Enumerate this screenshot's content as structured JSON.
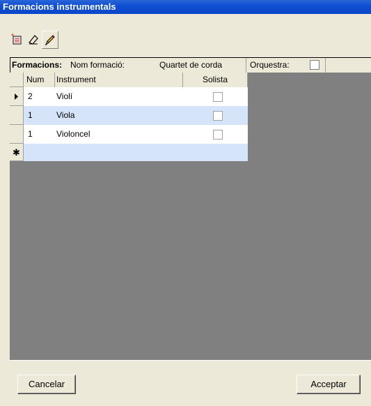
{
  "window": {
    "title": "Formacions instrumentals"
  },
  "toolbar": {
    "buttons": [
      {
        "icon": "new-record-icon"
      },
      {
        "icon": "eraser-icon"
      },
      {
        "icon": "pencil-icon",
        "pressed": true
      }
    ]
  },
  "header": {
    "section_label": "Formacions:",
    "name_label": "Nom formació:",
    "name_value": "Quartet de corda",
    "orchestra_label": "Orquestra:",
    "orchestra_checked": false
  },
  "grid": {
    "columns": [
      "Num",
      "Instrument",
      "Solista"
    ],
    "rows": [
      {
        "num": "2",
        "instrument": "Violí",
        "solista": false,
        "current": true
      },
      {
        "num": "1",
        "instrument": "Viola",
        "solista": false
      },
      {
        "num": "1",
        "instrument": "Violoncel",
        "solista": false
      }
    ],
    "new_row_marker": "✱"
  },
  "footer": {
    "cancel_label": "Cancelar",
    "accept_label": "Acceptar"
  },
  "colors": {
    "title_bar": "#0a46c8",
    "row_alt": "#d6e4fa",
    "row": "#ffffff",
    "empty_area": "#808080",
    "face": "#ece9d8"
  }
}
